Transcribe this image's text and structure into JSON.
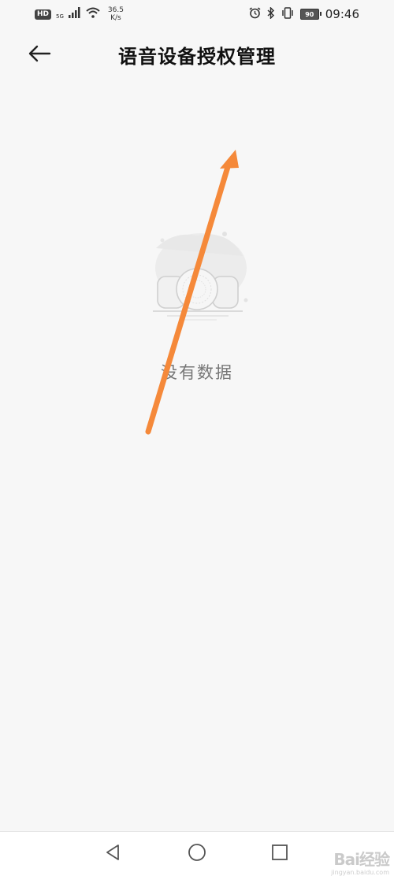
{
  "status_bar": {
    "hd": "HD",
    "network_small": "5G",
    "speed_value": "36.5",
    "speed_unit": "K/s",
    "battery": "90",
    "time": "09:46",
    "icons": [
      "signal-icon",
      "wifi-icon",
      "alarm-icon",
      "bluetooth-icon",
      "vibrate-icon",
      "battery-icon"
    ]
  },
  "header": {
    "title": "语音设备授权管理",
    "back_icon": "arrow-left-icon"
  },
  "empty_state": {
    "icon": "empty-device-illustration",
    "text": "没有数据"
  },
  "annotation": {
    "color": "#f5893a"
  },
  "nav_bar": {
    "icons": [
      "triangle-back-icon",
      "circle-home-icon",
      "square-recent-icon"
    ]
  },
  "watermark": {
    "text": "Bai经验",
    "sub": "jingyan.baidu.com"
  }
}
